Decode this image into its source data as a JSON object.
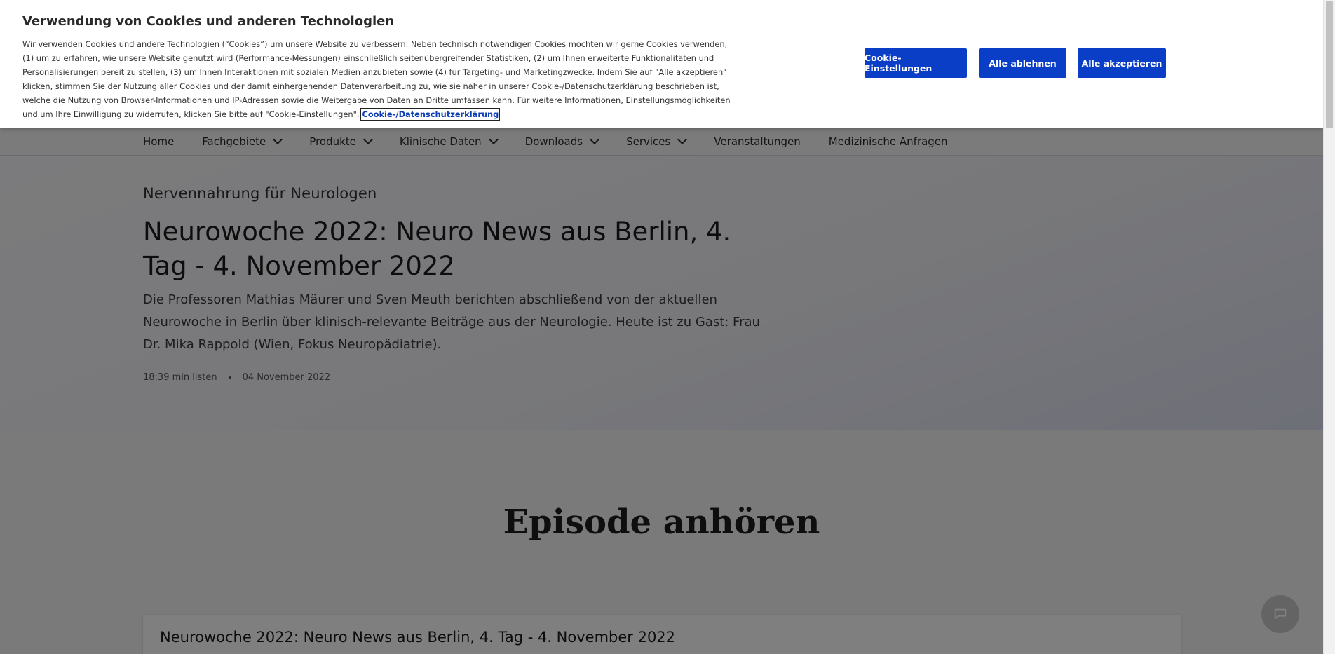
{
  "cookie_banner": {
    "title": "Verwendung von Cookies und anderen Technologien",
    "text": "Wir verwenden Cookies und andere Technologien (“Cookies”) um unsere Website zu verbessern. Neben technisch notwendigen Cookies möchten wir gerne Cookies verwenden, (1) um zu erfahren, wie unsere Website genutzt wird (Performance-Messungen) einschließlich seitenübergreifender Statistiken, (2) um Ihnen erweiterte Funktionalitäten und Personalisierungen bereit zu stellen, (3) um Ihnen Interaktionen mit sozialen Medien anzubieten sowie (4) für Targeting- und Marketingzwecke. Indem Sie auf \"Alle akzeptieren\" klicken, stimmen Sie der Nutzung aller Cookies und der damit einhergehenden Datenverarbeitung zu, wie sie näher in unserer Cookie-/Datenschutzerklärung beschrieben ist, welche die Nutzung von Browser-Informationen und IP-Adressen sowie die Weitergabe von Daten an Dritte umfassen kann. Für weitere Informationen, Einstellungsmöglichkeiten und um Ihre Einwilligung zu widerrufen, klicken Sie bitte auf \"Cookie-Einstellungen\".",
    "link_label": "Cookie-/Datenschutzerklärung",
    "buttons": {
      "settings": "Cookie-Einstellungen",
      "reject": "Alle ablehnen",
      "accept": "Alle akzeptieren"
    }
  },
  "nav": {
    "items": [
      {
        "label": "Home",
        "dropdown": false
      },
      {
        "label": "Fachgebiete",
        "dropdown": true
      },
      {
        "label": "Produkte",
        "dropdown": true
      },
      {
        "label": "Klinische Daten",
        "dropdown": true
      },
      {
        "label": "Downloads",
        "dropdown": true
      },
      {
        "label": "Services",
        "dropdown": true
      },
      {
        "label": "Veranstaltungen",
        "dropdown": false
      },
      {
        "label": "Medizinische Anfragen",
        "dropdown": false
      }
    ]
  },
  "hero": {
    "kicker": "Nervennahrung für Neurologen",
    "title": "Neurowoche 2022: Neuro News aus Berlin, 4. Tag - 4. November 2022",
    "description": "Die Professoren Mathias Mäurer und Sven Meuth berichten abschließend von der aktuellen Neurowoche in Berlin über klinisch-relevante Beiträge aus der Neurologie. Heute ist zu Gast: Frau Dr. Mika Rappold (Wien, Fokus Neuropädiatrie).",
    "duration": "18:39 min listen",
    "date": "04 November 2022"
  },
  "episode_section": {
    "title": "Episode anhören",
    "episode_title": "Neurowoche 2022: Neuro News aus Berlin, 4. Tag - 4. November 2022"
  },
  "colors": {
    "primary_button": "#0b3ec6",
    "link": "#0b3db5"
  }
}
